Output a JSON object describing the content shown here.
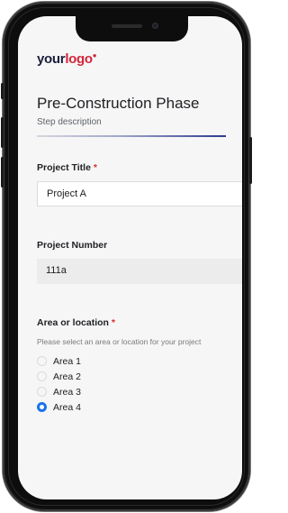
{
  "logo": {
    "part1": "your",
    "part2": "logo"
  },
  "form": {
    "title": "Pre-Construction Phase",
    "description": "Step description",
    "fields": {
      "project_title": {
        "label": "Project Title",
        "required_mark": "*",
        "value": "Project A"
      },
      "project_number": {
        "label": "Project Number",
        "value": "111a"
      },
      "area": {
        "label": "Area or location",
        "required_mark": "*",
        "help": "Please select an area or location for your project",
        "options": [
          {
            "label": "Area 1",
            "checked": false
          },
          {
            "label": "Area 2",
            "checked": false
          },
          {
            "label": "Area 3",
            "checked": false
          },
          {
            "label": "Area 4",
            "checked": true
          }
        ],
        "selected": "Area 4"
      }
    }
  },
  "colors": {
    "accent": "#1a73e8",
    "logo_red": "#d1263b",
    "required": "#d93025"
  }
}
